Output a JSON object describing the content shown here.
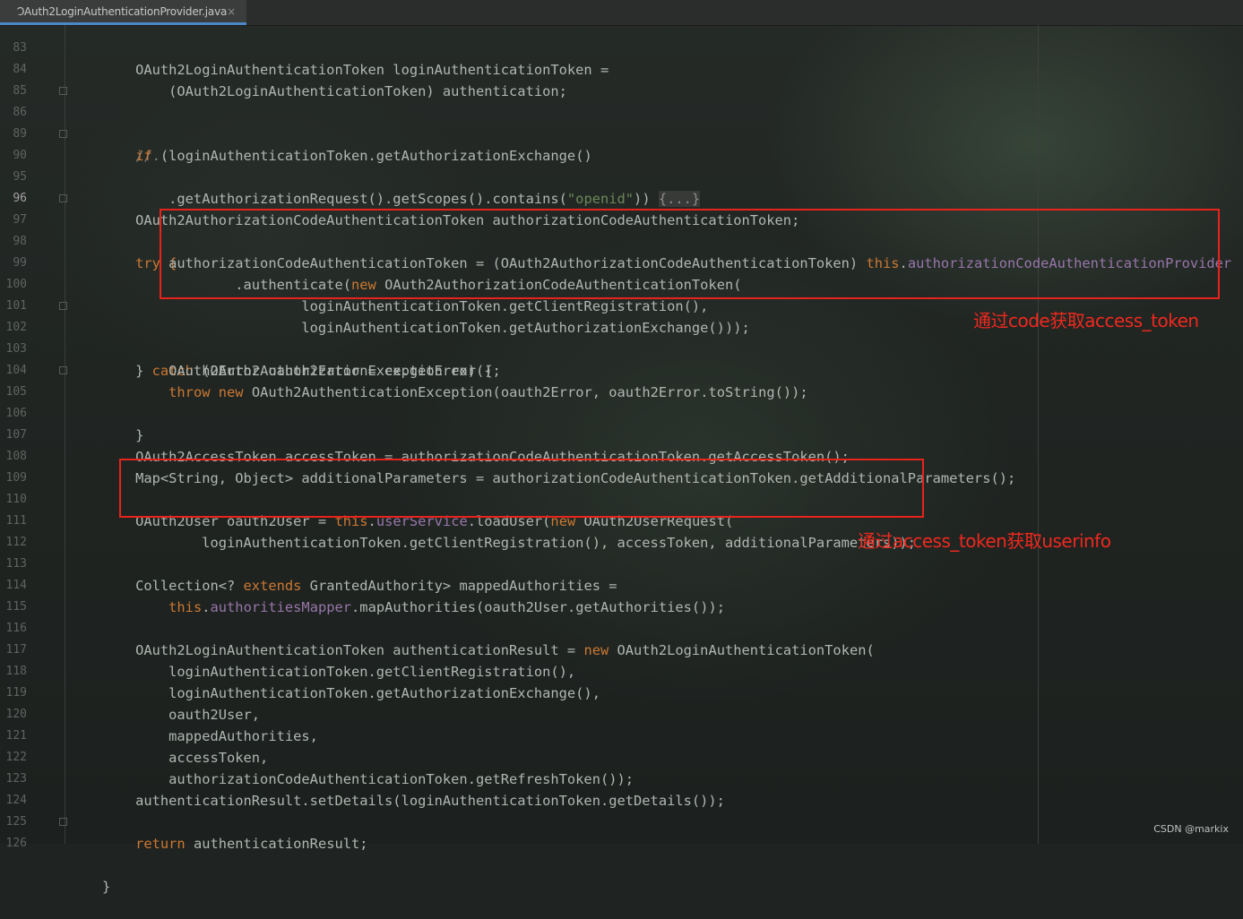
{
  "tab": {
    "title": "OAuth2LoginAuthenticationProvider.java",
    "close": "×",
    "icon": "java-class-icon"
  },
  "colors": {
    "keyword": "#cc7832",
    "field": "#9876aa",
    "string": "#6a8759",
    "annotation_red": "#e8231c",
    "text": "#b0b7b2"
  },
  "lines": [
    {
      "n": "83",
      "t": "    OAuth2LoginAuthenticationToken loginAuthenticationToken ="
    },
    {
      "n": "84",
      "t": "        (OAuth2LoginAuthenticationToken) authentication;"
    },
    {
      "n": "85",
      "t": ""
    },
    {
      "n": "86",
      "t": "    //..."
    },
    {
      "n": "89",
      "t": "    if (loginAuthenticationToken.getAuthorizationExchange()"
    },
    {
      "n": "90",
      "t": "        .getAuthorizationRequest().getScopes().contains(\"openid\")) {...}"
    },
    {
      "n": "95",
      "t": ""
    },
    {
      "n": "96",
      "t": "    OAuth2AuthorizationCodeAuthenticationToken authorizationCodeAuthenticationToken;"
    },
    {
      "n": "97",
      "t": "    try {"
    },
    {
      "n": "98",
      "t": "        authorizationCodeAuthenticationToken = (OAuth2AuthorizationCodeAuthenticationToken) this.authorizationCodeAuthenticationProvider"
    },
    {
      "n": "99",
      "t": "                .authenticate(new OAuth2AuthorizationCodeAuthenticationToken("
    },
    {
      "n": "100",
      "t": "                        loginAuthenticationToken.getClientRegistration(),"
    },
    {
      "n": "101",
      "t": "                        loginAuthenticationToken.getAuthorizationExchange()));"
    },
    {
      "n": "102",
      "t": "    } catch (OAuth2AuthorizationException ex) {"
    },
    {
      "n": "103",
      "t": "        OAuth2Error oauth2Error = ex.getError();"
    },
    {
      "n": "104",
      "t": "        throw new OAuth2AuthenticationException(oauth2Error, oauth2Error.toString());"
    },
    {
      "n": "105",
      "t": "    }"
    },
    {
      "n": "106",
      "t": ""
    },
    {
      "n": "107",
      "t": "    OAuth2AccessToken accessToken = authorizationCodeAuthenticationToken.getAccessToken();"
    },
    {
      "n": "108",
      "t": "    Map<String, Object> additionalParameters = authorizationCodeAuthenticationToken.getAdditionalParameters();"
    },
    {
      "n": "109",
      "t": ""
    },
    {
      "n": "110",
      "t": "    OAuth2User oauth2User = this.userService.loadUser(new OAuth2UserRequest("
    },
    {
      "n": "111",
      "t": "            loginAuthenticationToken.getClientRegistration(), accessToken, additionalParameters));"
    },
    {
      "n": "112",
      "t": ""
    },
    {
      "n": "113",
      "t": "    Collection<? extends GrantedAuthority> mappedAuthorities ="
    },
    {
      "n": "114",
      "t": "        this.authoritiesMapper.mapAuthorities(oauth2User.getAuthorities());"
    },
    {
      "n": "115",
      "t": ""
    },
    {
      "n": "116",
      "t": "    OAuth2LoginAuthenticationToken authenticationResult = new OAuth2LoginAuthenticationToken("
    },
    {
      "n": "117",
      "t": "        loginAuthenticationToken.getClientRegistration(),"
    },
    {
      "n": "118",
      "t": "        loginAuthenticationToken.getAuthorizationExchange(),"
    },
    {
      "n": "119",
      "t": "        oauth2User,"
    },
    {
      "n": "120",
      "t": "        mappedAuthorities,"
    },
    {
      "n": "121",
      "t": "        accessToken,"
    },
    {
      "n": "122",
      "t": "        authorizationCodeAuthenticationToken.getRefreshToken());"
    },
    {
      "n": "123",
      "t": "    authenticationResult.setDetails(loginAuthenticationToken.getDetails());"
    },
    {
      "n": "124",
      "t": ""
    },
    {
      "n": "125",
      "t": "    return authenticationResult;"
    },
    {
      "n": "126",
      "t": "}"
    }
  ],
  "annotations": {
    "code_to_token": "通过code获取access_token",
    "token_to_userinfo": "通过access_token获取userinfo"
  },
  "watermark": "CSDN @markix"
}
